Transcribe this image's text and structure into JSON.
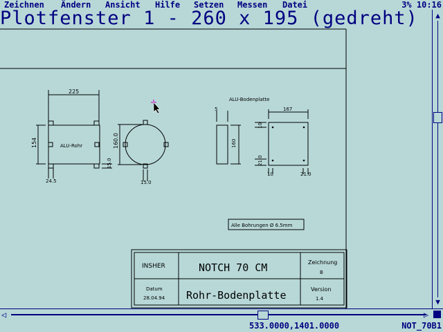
{
  "menu": {
    "items": [
      "Zeichnen",
      "Ändern",
      "Ansicht",
      "Hilfe",
      "Setzen",
      "Messen",
      "Datei"
    ],
    "zoom": "3%",
    "time": "10:16"
  },
  "window": {
    "title": "Plotfenster 1 - 260 x 195 (gedreht)"
  },
  "drawing": {
    "dims": {
      "pipe_width": "225",
      "pipe_height": "154",
      "pipe_foot": "15.0",
      "pipe_offset": "24.5",
      "circle_dia": "160.0",
      "circle_foot": "15.0",
      "plate_thickness": "5",
      "plate_height": "160",
      "plate_width": "167",
      "hole_top": "10",
      "hole_side": "21.0",
      "hole_bottom": "10",
      "hole_bottom_right": "21.0",
      "hole_left": "21.0"
    },
    "labels": {
      "pipe": "ALU-Rohr",
      "plate_title": "ALU-Bodenplatte",
      "note": "Alle Bohrungen Ø 6.5mm"
    },
    "titleblock": {
      "company": "INSHER",
      "project": "NOTCH 70 CM",
      "drawing_label": "Zeichnung",
      "drawing_value": "B",
      "date_label": "Datum",
      "date_value": "28.04.94",
      "part": "Rohr-Bodenplatte",
      "version_label": "Version",
      "version_value": "1.4"
    }
  },
  "status": {
    "coords": "533.0000,1401.0000",
    "file": "NOT_70B1"
  },
  "colors": {
    "background": "#b8d8d8",
    "ui_text": "#000080",
    "ink": "#000000"
  }
}
